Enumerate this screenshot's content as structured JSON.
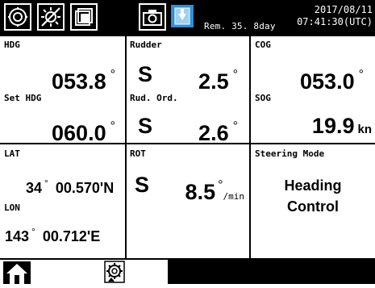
{
  "statusbar": {
    "remaining": "Rem. 35. 8day",
    "date": "2017/08/11",
    "time": "07:41:30(UTC)"
  },
  "heading": {
    "hdg_label": "HDG",
    "hdg_value": "053.8",
    "set_label": "Set HDG",
    "set_value": "060.0"
  },
  "rudder": {
    "rudder_label": "Rudder",
    "rudder_side": "S",
    "rudder_value": "2.5",
    "order_label": "Rud. Ord.",
    "order_side": "S",
    "order_value": "2.6"
  },
  "course": {
    "cog_label": "COG",
    "cog_value": "053.0",
    "sog_label": "SOG",
    "sog_value": "19.9",
    "sog_unit": "kn"
  },
  "position": {
    "lat_label": "LAT",
    "lat_deg": "34",
    "lat_min": "00.570'N",
    "lon_label": "LON",
    "lon_deg": "143",
    "lon_min": "00.712'E"
  },
  "rot": {
    "label": "ROT",
    "side": "S",
    "value": "8.5",
    "unit": "/min"
  },
  "steering": {
    "label": "Steering Mode",
    "mode_line1": "Heading",
    "mode_line2": "Control"
  },
  "colors": {
    "background": "#000000",
    "panel": "#ffffff",
    "accent": "#2f8fd8"
  },
  "icons": [
    "display-settings-icon",
    "brightness-icon",
    "window-layers-icon",
    "camera-icon",
    "download-icon",
    "home-icon",
    "gear-settings-icon"
  ]
}
